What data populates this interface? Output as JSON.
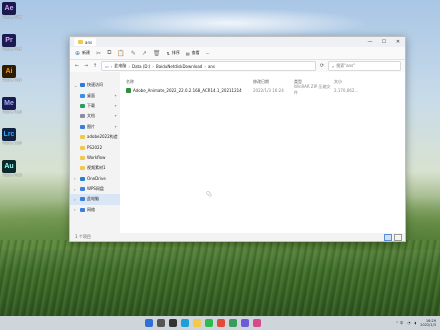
{
  "desktop_icons": [
    {
      "abbr": "Ae",
      "label": "Adobe After Effects 2020",
      "bg": "#1a1b4b",
      "fg": "#c8a2ff"
    },
    {
      "abbr": "Pr",
      "label": "Adobe Premiere Pro",
      "bg": "#1b1b4d",
      "fg": "#d1a6ff"
    },
    {
      "abbr": "Ai",
      "label": "Adobe Illustrator",
      "bg": "#2f1a02",
      "fg": "#ff9a00"
    },
    {
      "abbr": "Me",
      "label": "Adobe Media Encoder",
      "bg": "#1b1b4d",
      "fg": "#9ab1ff"
    },
    {
      "abbr": "Lrc",
      "label": "Adobe Lightroom",
      "bg": "#0f2240",
      "fg": "#31a8ff"
    },
    {
      "abbr": "Au",
      "label": "Adobe Audition",
      "bg": "#0a2a2a",
      "fg": "#9ff"
    }
  ],
  "window": {
    "tab_title": "ans",
    "controls": {
      "minimize": "—",
      "maximize": "☐",
      "close": "✕"
    },
    "toolbar": {
      "new_label": "新建",
      "sort_label": "排序",
      "view_label": "查看",
      "more_label": "···"
    },
    "nav": {
      "back": "←",
      "forward": "→",
      "up": "↑",
      "refresh": "⟳"
    },
    "breadcrumb": [
      "此电脑",
      "Data (D:)",
      "BaiduNetdiskDownload",
      "ans"
    ],
    "search_placeholder": "搜索\"ans\"",
    "sidebar": [
      {
        "label": "快速访问",
        "icon": "star-icon",
        "color": "#2e7bd6",
        "chev": "⌄",
        "pinned": false,
        "selected": false
      },
      {
        "label": "桌面",
        "icon": "desktop-icon",
        "color": "#3a8ee6",
        "chev": "",
        "pinned": true,
        "selected": false
      },
      {
        "label": "下载",
        "icon": "download-icon",
        "color": "#2a9d6a",
        "chev": "",
        "pinned": true,
        "selected": false
      },
      {
        "label": "文档",
        "icon": "document-icon",
        "color": "#8a8fa0",
        "chev": "",
        "pinned": true,
        "selected": false
      },
      {
        "label": "图片",
        "icon": "picture-icon",
        "color": "#3b7ddd",
        "chev": "",
        "pinned": true,
        "selected": false
      },
      {
        "label": "adobe2022构造",
        "icon": "folder-icon",
        "color": "#f2c94c",
        "chev": "",
        "pinned": false,
        "selected": false
      },
      {
        "label": "PS2022",
        "icon": "folder-icon",
        "color": "#f2c94c",
        "chev": "",
        "pinned": false,
        "selected": false
      },
      {
        "label": "Workflow",
        "icon": "folder-icon",
        "color": "#f2c94c",
        "chev": "",
        "pinned": false,
        "selected": false
      },
      {
        "label": "视频素材1",
        "icon": "folder-icon",
        "color": "#f2c94c",
        "chev": "",
        "pinned": false,
        "selected": false
      },
      {
        "label": "OneDrive",
        "icon": "cloud-icon",
        "color": "#2b7cd3",
        "chev": "›",
        "pinned": false,
        "selected": false
      },
      {
        "label": "WPS网盘",
        "icon": "cloud-icon",
        "color": "#3f7fe0",
        "chev": "›",
        "pinned": false,
        "selected": false
      },
      {
        "label": "此电脑",
        "icon": "computer-icon",
        "color": "#3b7ddd",
        "chev": "›",
        "pinned": false,
        "selected": true
      },
      {
        "label": "网络",
        "icon": "network-icon",
        "color": "#3b7ddd",
        "chev": "›",
        "pinned": false,
        "selected": false
      }
    ],
    "columns": {
      "name": "名称",
      "date": "修改日期",
      "type": "类型",
      "size": "大小"
    },
    "files": [
      {
        "name": "Adobe_Animate_2022_22.0.2.168_ACR14.1_20211214",
        "date": "2022/1/3 16:24",
        "type": "WinRAR ZIP 压缩文件",
        "size": "2,170,062..."
      }
    ],
    "status": "1 个项目"
  },
  "taskbar": {
    "apps": [
      {
        "name": "start-icon",
        "color": "#2f6fd6"
      },
      {
        "name": "search-icon",
        "color": "#555"
      },
      {
        "name": "task-view-icon",
        "color": "#333"
      },
      {
        "name": "edge-icon",
        "color": "#1f9fd8"
      },
      {
        "name": "file-explorer-icon",
        "color": "#f2c94c"
      },
      {
        "name": "wechat-icon",
        "color": "#2dbb4e"
      },
      {
        "name": "chrome-icon",
        "color": "#e34a3a"
      },
      {
        "name": "app-icon",
        "color": "#3a9a5a"
      },
      {
        "name": "app-icon",
        "color": "#6c5bd6"
      },
      {
        "name": "app-icon",
        "color": "#d64a8a"
      }
    ],
    "tray_text": "^ 中",
    "time": "16:29",
    "date": "2022/1/3"
  }
}
